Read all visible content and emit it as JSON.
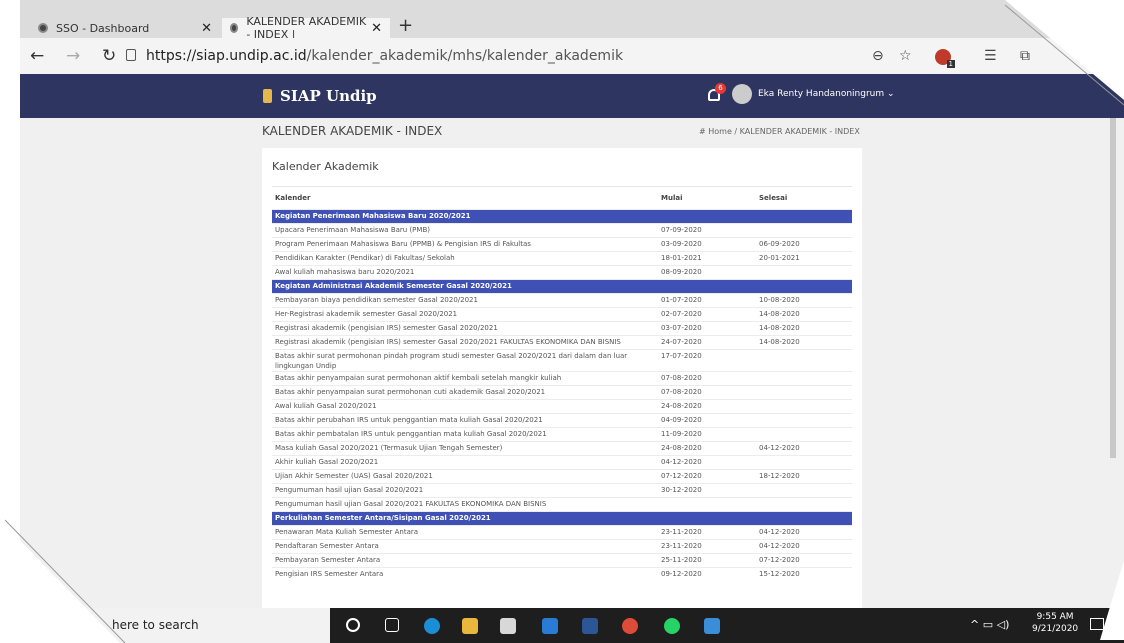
{
  "browser": {
    "tabs": [
      {
        "title": "SSO - Dashboard"
      },
      {
        "title": "KALENDER AKADEMIK - INDEX |"
      }
    ],
    "url_host": "https://siap.undip.ac.id",
    "url_path": "/kalender_akademik/mhs/kalender_akademik",
    "ext_badge": "1"
  },
  "header": {
    "brand": "SIAP Undip",
    "notif_count": "6",
    "user_name": "Eka Renty Handanoningrum ⌄"
  },
  "page": {
    "title": "KALENDER AKADEMIK - INDEX",
    "breadcrumb": "# Home  /  KALENDER AKADEMIK - INDEX",
    "card_title": "Kalender Akademik"
  },
  "table": {
    "headers": [
      "Kalender",
      "Mulai",
      "Selesai"
    ],
    "groups": [
      {
        "name": "Kegiatan Penerimaan Mahasiswa Baru 2020/2021",
        "rows": [
          [
            "Upacara Penerimaan Mahasiswa Baru (PMB)",
            "07-09-2020",
            ""
          ],
          [
            "Program Penerimaan Mahasiswa Baru (PPMB) & Pengisian IRS di Fakultas",
            "03-09-2020",
            "06-09-2020"
          ],
          [
            "Pendidikan Karakter (Pendikar) di Fakultas/ Sekolah",
            "18-01-2021",
            "20-01-2021"
          ],
          [
            "Awal kuliah mahasiswa baru 2020/2021",
            "08-09-2020",
            ""
          ]
        ]
      },
      {
        "name": "Kegiatan Administrasi Akademik Semester Gasal 2020/2021",
        "rows": [
          [
            "Pembayaran biaya pendidikan semester Gasal 2020/2021",
            "01-07-2020",
            "10-08-2020"
          ],
          [
            "Her-Registrasi akademik semester Gasal 2020/2021",
            "02-07-2020",
            "14-08-2020"
          ],
          [
            "Registrasi akademik (pengisian IRS) semester Gasal 2020/2021",
            "03-07-2020",
            "14-08-2020"
          ],
          [
            "Registrasi akademik (pengisian IRS) semester Gasal 2020/2021 FAKULTAS EKONOMIKA DAN BISNIS",
            "24-07-2020",
            "14-08-2020"
          ],
          [
            "Batas akhir surat permohonan pindah program studi semester Gasal 2020/2021 dari dalam dan luar lingkungan Undip",
            "17-07-2020",
            ""
          ],
          [
            "Batas akhir penyampaian surat permohonan aktif kembali setelah mangkir kuliah",
            "07-08-2020",
            ""
          ],
          [
            "Batas akhir penyampaian surat permohonan cuti akademik Gasal 2020/2021",
            "07-08-2020",
            ""
          ],
          [
            "Awal kuliah Gasal 2020/2021",
            "24-08-2020",
            ""
          ],
          [
            "Batas akhir perubahan IRS untuk penggantian mata kuliah Gasal 2020/2021",
            "04-09-2020",
            ""
          ],
          [
            "Batas akhir pembatalan IRS untuk penggantian mata kuliah Gasal 2020/2021",
            "11-09-2020",
            ""
          ],
          [
            "Masa kuliah Gasal 2020/2021 (Termasuk Ujian Tengah Semester)",
            "24-08-2020",
            "04-12-2020"
          ],
          [
            "Akhir kuliah Gasal 2020/2021",
            "04-12-2020",
            ""
          ],
          [
            "Ujian Akhir Semester (UAS) Gasal 2020/2021",
            "07-12-2020",
            "18-12-2020"
          ],
          [
            "Pengumuman hasil ujian Gasal 2020/2021",
            "30-12-2020",
            ""
          ],
          [
            "Pengumuman hasil ujian Gasal 2020/2021 FAKULTAS EKONOMIKA DAN BISNIS",
            "",
            ""
          ]
        ]
      },
      {
        "name": "Perkuliahan Semester Antara/Sisipan Gasal 2020/2021",
        "rows": [
          [
            "Penawaran Mata Kuliah Semester Antara",
            "23-11-2020",
            "04-12-2020"
          ],
          [
            "Pendaftaran Semester Antara",
            "23-11-2020",
            "04-12-2020"
          ],
          [
            "Pembayaran Semester Antara",
            "25-11-2020",
            "07-12-2020"
          ],
          [
            "Pengisian IRS Semester Antara",
            "09-12-2020",
            "15-12-2020"
          ]
        ]
      }
    ]
  },
  "taskbar": {
    "search_text": "here to search",
    "time": "9:55 AM",
    "date": "9/21/2020"
  }
}
